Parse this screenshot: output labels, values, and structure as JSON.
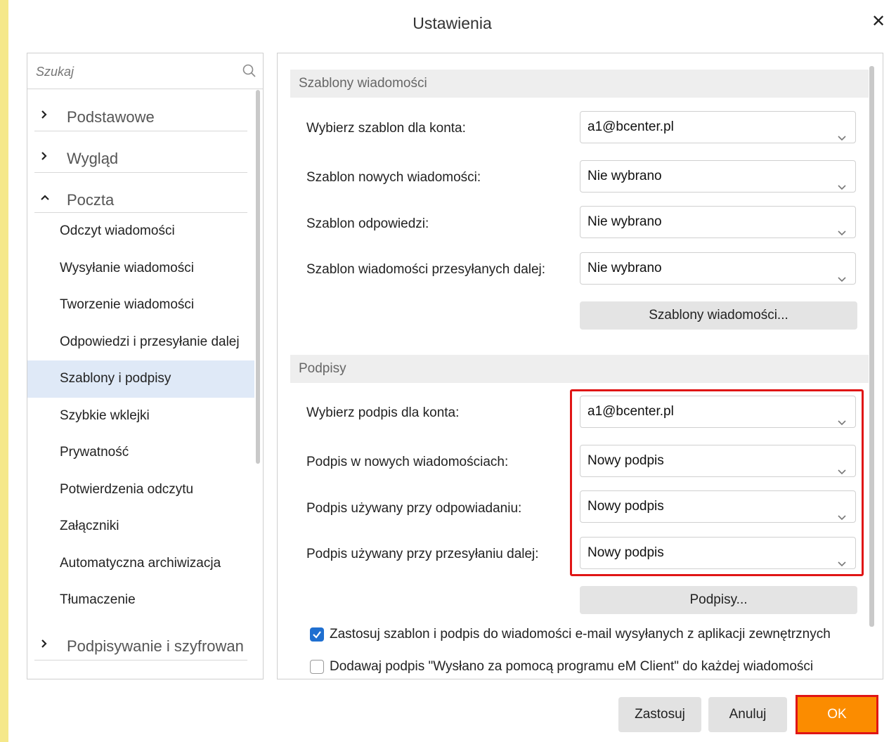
{
  "dialog": {
    "title": "Ustawienia",
    "close_glyph": "✕"
  },
  "search": {
    "placeholder": "Szukaj",
    "icon": "search-icon"
  },
  "nav": {
    "categories": [
      {
        "label": "Podstawowe",
        "expanded": false
      },
      {
        "label": "Wygląd",
        "expanded": false
      },
      {
        "label": "Poczta",
        "expanded": true
      },
      {
        "label": "Podpisywanie i szyfrowan",
        "expanded": false
      }
    ],
    "mail_items": [
      "Odczyt wiadomości",
      "Wysyłanie wiadomości",
      "Tworzenie wiadomości",
      "Odpowiedzi i przesyłanie dalej",
      "Szablony i podpisy",
      "Szybkie wklejki",
      "Prywatność",
      "Potwierdzenia odczytu",
      "Załączniki",
      "Automatyczna archiwizacja",
      "Tłumaczenie"
    ],
    "active_item": "Szablony i podpisy"
  },
  "templates": {
    "header": "Szablony wiadomości",
    "rows": [
      {
        "label": "Wybierz szablon dla konta:",
        "value": "a1@bcenter.pl"
      },
      {
        "label": "Szablon nowych wiadomości:",
        "value": "Nie wybrano"
      },
      {
        "label": "Szablon odpowiedzi:",
        "value": "Nie wybrano"
      },
      {
        "label": "Szablon wiadomości przesyłanych dalej:",
        "value": "Nie wybrano"
      }
    ],
    "button": "Szablony wiadomości..."
  },
  "signatures": {
    "header": "Podpisy",
    "rows": [
      {
        "label": "Wybierz podpis dla konta:",
        "value": "a1@bcenter.pl"
      },
      {
        "label": "Podpis w nowych wiadomościach:",
        "value": "Nowy podpis"
      },
      {
        "label": "Podpis używany przy odpowiadaniu:",
        "value": "Nowy podpis"
      },
      {
        "label": "Podpis używany przy przesyłaniu dalej:",
        "value": "Nowy podpis"
      }
    ],
    "button": "Podpisy..."
  },
  "options": {
    "apply_external": {
      "label": "Zastosuj szablon i podpis do wiadomości e-mail wysyłanych z aplikacji zewnętrznych",
      "checked": true
    },
    "add_sent_with": {
      "label": "Dodawaj podpis \"Wysłano za pomocą programu eM Client\" do każdej wiadomości",
      "checked": false
    }
  },
  "footer": {
    "apply": "Zastosuj",
    "cancel": "Anuluj",
    "ok": "OK"
  },
  "colors": {
    "accent_ok": "#fb8c00",
    "highlight": "#e01515",
    "active_nav": "#dfe9f7",
    "checkbox": "#1f6fd0"
  }
}
